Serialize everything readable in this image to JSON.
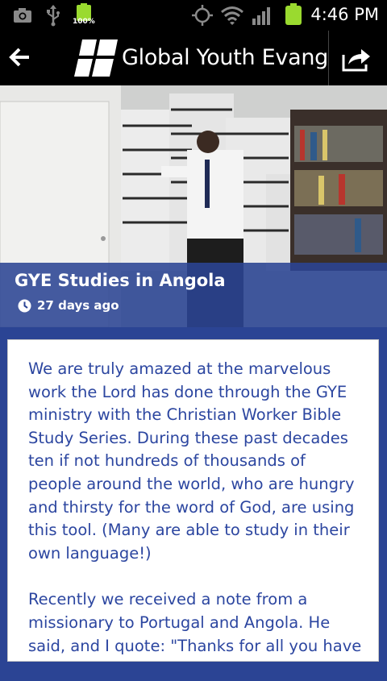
{
  "status_bar": {
    "time": "4:46 PM",
    "battery_percent": "100%",
    "icons": [
      "camera-icon",
      "usb-icon",
      "battery-icon",
      "gps-icon",
      "wifi-icon",
      "signal-icon",
      "battery-full-icon"
    ]
  },
  "action_bar": {
    "title": "Global Youth Evangelism",
    "back_icon": "back-arrow-icon",
    "share_icon": "share-icon"
  },
  "article": {
    "title": "GYE Studies in Angola",
    "age": "27 days ago",
    "paragraphs": [
      "We are truly amazed at the marvelous work the Lord has done through the GYE ministry with the Christian Worker Bible Study Series. During these past decades ten if not hundreds of thousands of people around the world, who are hungry and thirsty for the word of God, are using this tool. (Many are able to study in their own language!)",
      "Recently we received a note from a missionary to Portugal and Angola. He said, and I quote: \"Thanks for all you have"
    ]
  },
  "colors": {
    "brand_blue": "#2b4494",
    "text_blue": "#2c46a0",
    "battery_green": "#9ada2f"
  }
}
